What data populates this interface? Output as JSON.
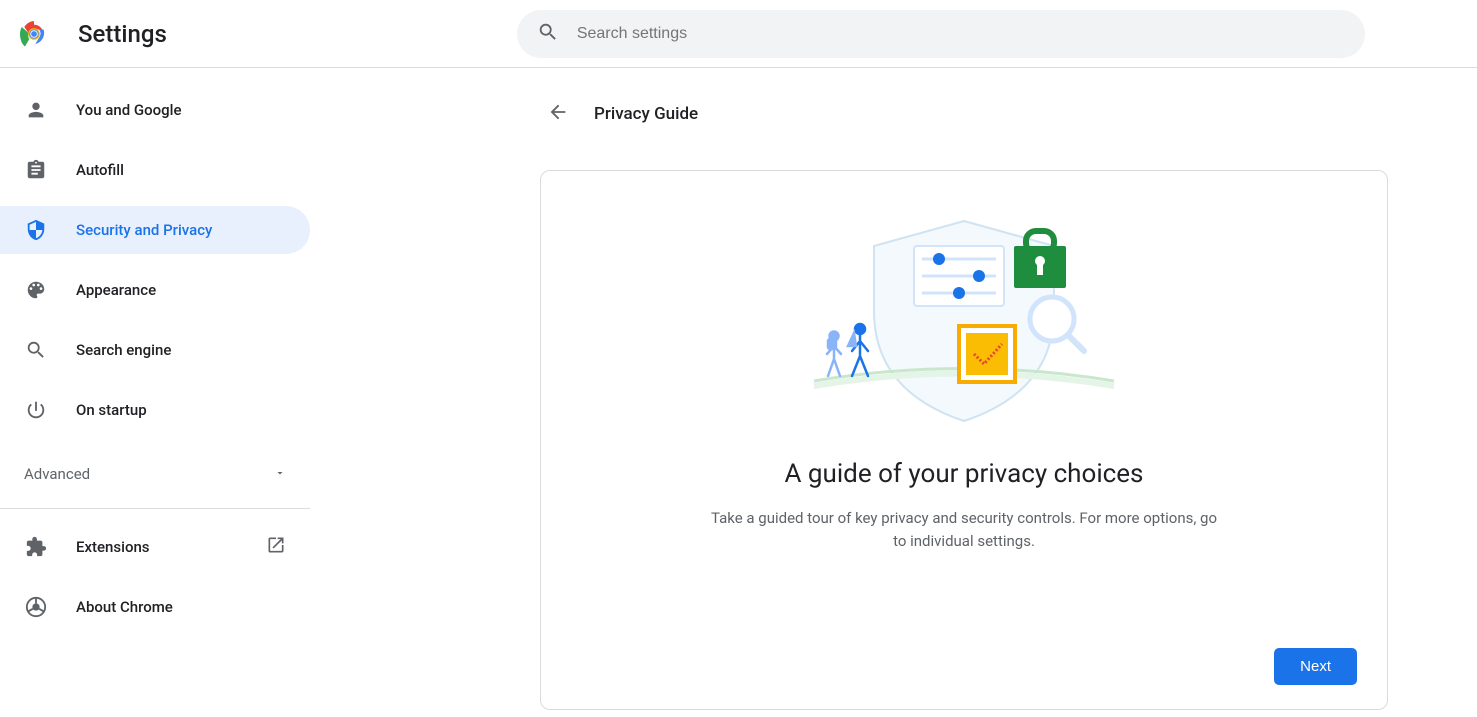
{
  "app": {
    "title": "Settings"
  },
  "search": {
    "placeholder": "Search settings"
  },
  "sidebar": {
    "items": [
      {
        "label": "You and Google"
      },
      {
        "label": "Autofill"
      },
      {
        "label": "Security and Privacy"
      },
      {
        "label": "Appearance"
      },
      {
        "label": "Search engine"
      },
      {
        "label": "On startup"
      }
    ],
    "advanced": "Advanced",
    "footer": [
      {
        "label": "Extensions"
      },
      {
        "label": "About Chrome"
      }
    ]
  },
  "page": {
    "title": "Privacy Guide",
    "heading": "A guide of your privacy choices",
    "description": "Take a guided tour of key privacy and security controls. For more options, go to individual settings.",
    "next": "Next"
  },
  "colors": {
    "accent": "#1a73e8",
    "accentBg": "#e8f0fe"
  }
}
